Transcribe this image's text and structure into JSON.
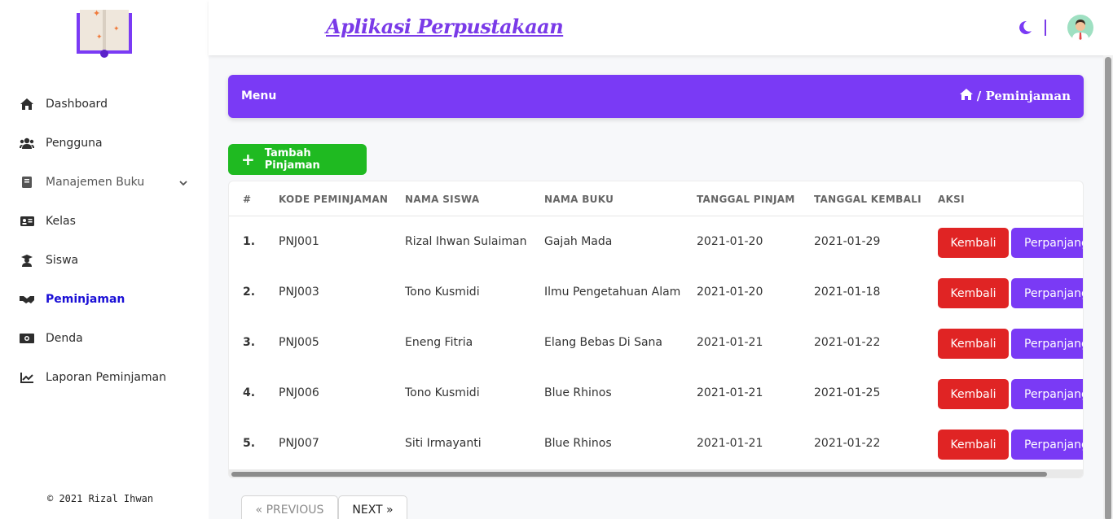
{
  "app": {
    "title": "Aplikasi Perpustakaan"
  },
  "sidebar": {
    "items": [
      {
        "label": "Dashboard",
        "icon": "home-icon"
      },
      {
        "label": "Pengguna",
        "icon": "users-icon"
      },
      {
        "label": "Manajemen Buku",
        "icon": "book-icon",
        "expandable": true
      },
      {
        "label": "Kelas",
        "icon": "id-card-icon"
      },
      {
        "label": "Siswa",
        "icon": "graduate-icon"
      },
      {
        "label": "Peminjaman",
        "icon": "handshake-icon",
        "active": true
      },
      {
        "label": "Denda",
        "icon": "money-icon"
      },
      {
        "label": "Laporan Peminjaman",
        "icon": "chart-line-icon"
      }
    ],
    "copyright": "© 2021 Rizal Ihwan"
  },
  "banner": {
    "menu_label": "Menu",
    "breadcrumb": "/ Peminjaman"
  },
  "add_button": {
    "label": "Tambah Pinjaman"
  },
  "table": {
    "headers": [
      "#",
      "KODE PEMINJAMAN",
      "NAMA SISWA",
      "NAMA BUKU",
      "TANGGAL PINJAM",
      "TANGGAL KEMBALI",
      "AKSI"
    ],
    "rows": [
      {
        "num": "1.",
        "kode": "PNJ001",
        "siswa": "Rizal Ihwan Sulaiman",
        "buku": "Gajah Mada",
        "pinjam": "2021-01-20",
        "kembali": "2021-01-29"
      },
      {
        "num": "2.",
        "kode": "PNJ003",
        "siswa": "Tono Kusmidi",
        "buku": "Ilmu Pengetahuan Alam",
        "pinjam": "2021-01-20",
        "kembali": "2021-01-18"
      },
      {
        "num": "3.",
        "kode": "PNJ005",
        "siswa": "Eneng Fitria",
        "buku": "Elang Bebas Di Sana",
        "pinjam": "2021-01-21",
        "kembali": "2021-01-22"
      },
      {
        "num": "4.",
        "kode": "PNJ006",
        "siswa": "Tono Kusmidi",
        "buku": "Blue Rhinos",
        "pinjam": "2021-01-21",
        "kembali": "2021-01-25"
      },
      {
        "num": "5.",
        "kode": "PNJ007",
        "siswa": "Siti Irmayanti",
        "buku": "Blue Rhinos",
        "pinjam": "2021-01-21",
        "kembali": "2021-01-22"
      }
    ],
    "action_return": "Kembali",
    "action_extend": "Perpanjang"
  },
  "pagination": {
    "prev": "« PREVIOUS",
    "next": "NEXT »"
  },
  "colors": {
    "accent": "#7a3af5",
    "success": "#1fba21",
    "danger": "#e02424",
    "active_nav": "#1a0fd6"
  }
}
